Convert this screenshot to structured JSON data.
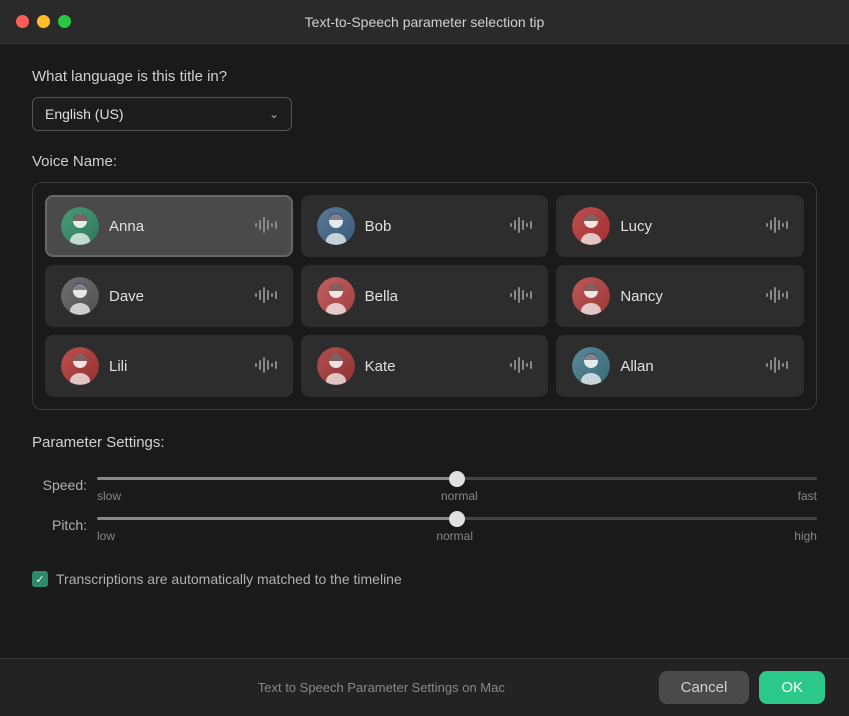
{
  "window": {
    "title": "Text-to-Speech parameter selection tip",
    "traffic_lights": [
      "close",
      "minimize",
      "maximize"
    ]
  },
  "language_section": {
    "label": "What language is this title in?",
    "dropdown_value": "English  (US)",
    "dropdown_placeholder": "English  (US)"
  },
  "voice_section": {
    "label": "Voice Name:",
    "voices": [
      {
        "id": "anna",
        "name": "Anna",
        "selected": true,
        "avatar_class": "avatar-anna",
        "avatar_symbol": "👩"
      },
      {
        "id": "bob",
        "name": "Bob",
        "selected": false,
        "avatar_class": "avatar-bob",
        "avatar_symbol": "👨"
      },
      {
        "id": "lucy",
        "name": "Lucy",
        "selected": false,
        "avatar_class": "avatar-lucy",
        "avatar_symbol": "👩"
      },
      {
        "id": "dave",
        "name": "Dave",
        "selected": false,
        "avatar_class": "avatar-dave",
        "avatar_symbol": "👨"
      },
      {
        "id": "bella",
        "name": "Bella",
        "selected": false,
        "avatar_class": "avatar-bella",
        "avatar_symbol": "👩"
      },
      {
        "id": "nancy",
        "name": "Nancy",
        "selected": false,
        "avatar_class": "avatar-nancy",
        "avatar_symbol": "👩"
      },
      {
        "id": "lili",
        "name": "Lili",
        "selected": false,
        "avatar_class": "avatar-lili",
        "avatar_symbol": "👩"
      },
      {
        "id": "kate",
        "name": "Kate",
        "selected": false,
        "avatar_class": "avatar-kate",
        "avatar_symbol": "👩"
      },
      {
        "id": "allan",
        "name": "Allan",
        "selected": false,
        "avatar_class": "avatar-allan",
        "avatar_symbol": "👨"
      }
    ]
  },
  "param_section": {
    "label": "Parameter Settings:",
    "speed": {
      "label": "Speed:",
      "value": 50,
      "min": 0,
      "max": 100,
      "ticks": [
        "slow",
        "normal",
        "fast"
      ]
    },
    "pitch": {
      "label": "Pitch:",
      "value": 50,
      "min": 0,
      "max": 100,
      "ticks": [
        "low",
        "normal",
        "high"
      ]
    }
  },
  "checkbox": {
    "label": "Transcriptions are automatically matched to the timeline",
    "checked": true
  },
  "bottom": {
    "center_text": "Text to Speech Parameter Settings on Mac",
    "cancel_label": "Cancel",
    "ok_label": "OK"
  }
}
